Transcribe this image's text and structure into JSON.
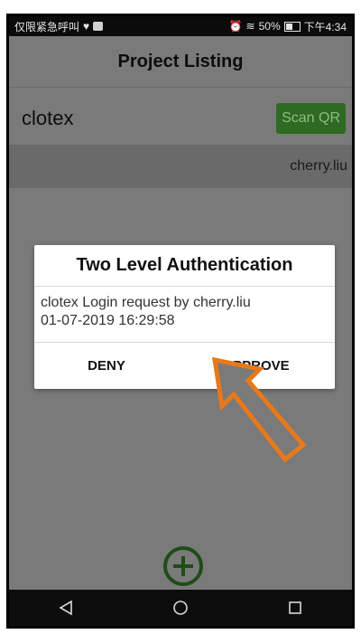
{
  "status_bar": {
    "left_text": "仅限紧急呼叫",
    "battery": "50%",
    "time": "下午4:34"
  },
  "app": {
    "title": "Project Listing"
  },
  "project": {
    "name": "clotex",
    "scan_button": "Scan QR",
    "user": "cherry.liu"
  },
  "dialog": {
    "title": "Two Level Authentication",
    "message_line1": "clotex Login request by cherry.liu",
    "message_line2": "01-07-2019 16:29:58",
    "deny": "DENY",
    "approve": "APPROVE"
  },
  "colors": {
    "scan_button_bg": "#2e6a22",
    "fab": "#1e4d16",
    "arrow": "#e8791a",
    "overlay": "#7a7a7a"
  }
}
